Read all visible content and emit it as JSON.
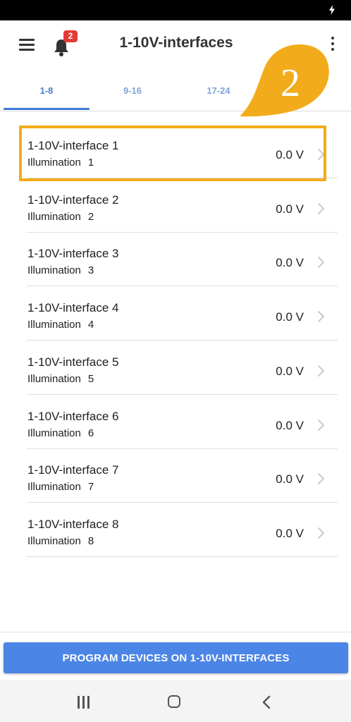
{
  "app_bar": {
    "title": "1-10V-interfaces",
    "notification_count": "2"
  },
  "tabs": [
    {
      "label": "1-8"
    },
    {
      "label": "9-16"
    },
    {
      "label": "17-24"
    }
  ],
  "callout": {
    "label": "2",
    "color": "#f2ac1b"
  },
  "interfaces": [
    {
      "name": "1-10V-interface 1",
      "type": "Illumination",
      "number": "1",
      "value": "0.0 V"
    },
    {
      "name": "1-10V-interface 2",
      "type": "Illumination",
      "number": "2",
      "value": "0.0 V"
    },
    {
      "name": "1-10V-interface 3",
      "type": "Illumination",
      "number": "3",
      "value": "0.0 V"
    },
    {
      "name": "1-10V-interface 4",
      "type": "Illumination",
      "number": "4",
      "value": "0.0 V"
    },
    {
      "name": "1-10V-interface 5",
      "type": "Illumination",
      "number": "5",
      "value": "0.0 V"
    },
    {
      "name": "1-10V-interface 6",
      "type": "Illumination",
      "number": "6",
      "value": "0.0 V"
    },
    {
      "name": "1-10V-interface 7",
      "type": "Illumination",
      "number": "7",
      "value": "0.0 V"
    },
    {
      "name": "1-10V-interface 8",
      "type": "Illumination",
      "number": "8",
      "value": "0.0 V"
    }
  ],
  "program_button": {
    "label": "PROGRAM DEVICES ON 1-10V-INTERFACES"
  },
  "colors": {
    "accent": "#4b85e6",
    "badge": "#e53935",
    "highlight": "#f2ac1b"
  }
}
